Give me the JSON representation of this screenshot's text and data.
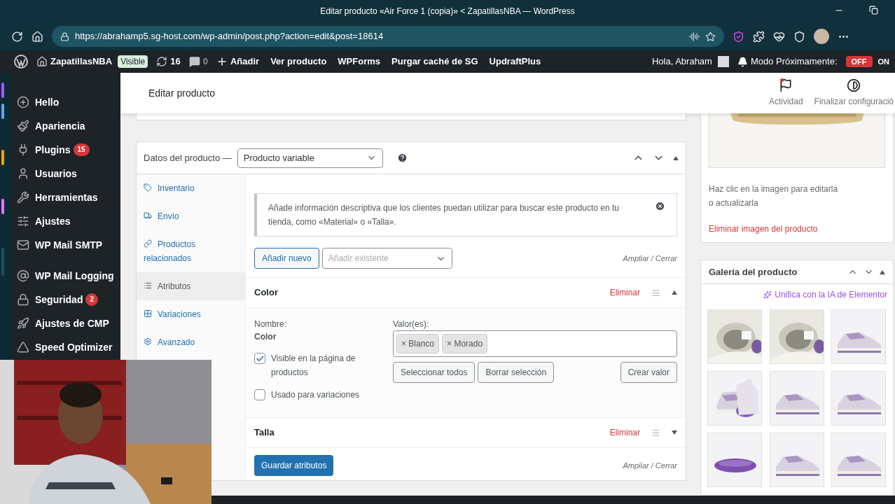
{
  "browser": {
    "title": "Editar producto «Air Force 1 (copia)» < ZapatillasNBA — WordPress",
    "url": "https://abrahamp5.sg-host.com/wp-admin/post.php?action=edit&post=18614"
  },
  "admin_bar": {
    "site": "ZapatillasNBA",
    "visibility": "Visible",
    "updates": "16",
    "comments": "0",
    "items": [
      "Añadir",
      "Ver producto",
      "WPForms",
      "Purgar caché de SG",
      "UpdraftPlus"
    ],
    "greeting": "Hola, Abraham",
    "coming_soon": {
      "label": "Modo Próximamente:",
      "off": "OFF",
      "on": "ON",
      "enabled": false
    }
  },
  "sidebar": {
    "items": [
      {
        "label": "Hello"
      },
      {
        "label": "Apariencia"
      },
      {
        "label": "Plugins",
        "badge": "15"
      },
      {
        "label": "Usuarios"
      },
      {
        "label": "Herramientas"
      },
      {
        "label": "Ajustes"
      },
      {
        "label": "WP Mail SMTP"
      },
      {
        "label": "WP Mail Logging"
      },
      {
        "label": "Seguridad",
        "badge": "2"
      },
      {
        "label": "Ajustes de CMP"
      },
      {
        "label": "Speed Optimizer"
      }
    ]
  },
  "header": {
    "title": "Editar producto",
    "actions": [
      "Actividad",
      "Finalizar configuració"
    ]
  },
  "product_data": {
    "label": "Datos del producto —",
    "type": "Producto variable",
    "tabs": [
      {
        "label": "Inventario",
        "selected": false
      },
      {
        "label": "Envío",
        "selected": false
      },
      {
        "label": "Productos relacionados",
        "selected": false
      },
      {
        "label": "Atributos",
        "selected": true
      },
      {
        "label": "Variaciones",
        "selected": false
      },
      {
        "label": "Avanzado",
        "selected": false
      }
    ],
    "notice": "Añade información descriptiva que los clientes puedan utilizar para buscar este producto en tu tienda, como «Material» o «Talla».",
    "add_new": "Añadir nuevo",
    "add_existing_placeholder": "Añadir existente",
    "expand_top": "Ampliar / Cerrar",
    "attributes": [
      {
        "name": "Color",
        "remove": "Eliminar",
        "expanded": true,
        "name_label": "Nombre:",
        "name_value": "Color",
        "values_label": "Valor(es):",
        "values": [
          "× Blanco",
          "× Morado"
        ],
        "visible": {
          "label": "Visible en la página de productos",
          "checked": true
        },
        "variations": {
          "label": "Usado para variaciones",
          "checked": false
        },
        "buttons": [
          "Seleccionar todos",
          "Borrar selección",
          "Crear valor"
        ]
      },
      {
        "name": "Talla",
        "remove": "Eliminar",
        "expanded": false
      }
    ],
    "save": "Guardar atributos",
    "expand_bottom": "Ampliar / Cerrar"
  },
  "product_image": {
    "hint": "Haz clic en la imagen para editarla o actualizarla",
    "remove": "Eliminar imagen del producto"
  },
  "gallery": {
    "title": "Galería del producto",
    "ai_link": "Unifica con la IA de Elementor"
  }
}
